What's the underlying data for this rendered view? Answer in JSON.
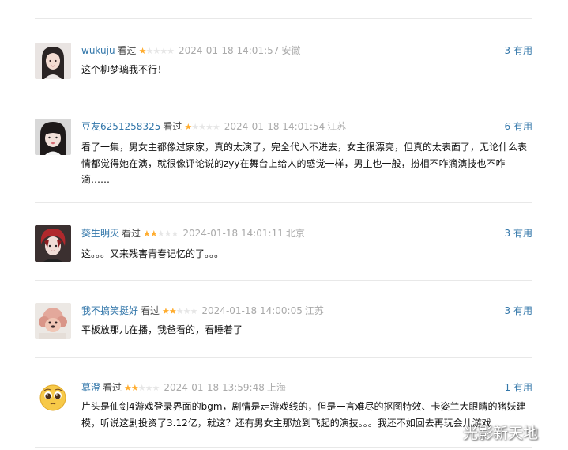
{
  "comments": [
    {
      "user": "wukuju",
      "status": "看过",
      "rating": 1,
      "time": "2024-01-18 14:01:57",
      "location": "安徽",
      "votes": "3 有用",
      "text": "这个柳梦璃我不行！",
      "avatar_icon": "avatar-girl-dark-hair"
    },
    {
      "user": "豆友6251258325",
      "status": "看过",
      "rating": 1,
      "time": "2024-01-18 14:01:54",
      "location": "江苏",
      "votes": "6 有用",
      "text": "看了一集，男女主都像过家家，真的太演了，完全代入不进去，女主很漂亮，但真的太表面了，无论什么表情都觉得她在演，就很像评论说的zyy在舞台上给人的感觉一样，男主也一般，扮相不咋滴演技也不咋滴……",
      "avatar_icon": "avatar-girl-bangs"
    },
    {
      "user": "葵生明灭",
      "status": "看过",
      "rating": 2,
      "time": "2024-01-18 14:01:11",
      "location": "北京",
      "votes": "3 有用",
      "text": "这。。。又来残害青春记忆的了。。。",
      "avatar_icon": "avatar-boy-red-hair"
    },
    {
      "user": "我不搞笑挺好",
      "status": "看过",
      "rating": 2,
      "time": "2024-01-18 14:00:05",
      "location": "江苏",
      "votes": "3 有用",
      "text": "平板放那儿在播，我爸看的，看睡着了",
      "avatar_icon": "avatar-pink-dog"
    },
    {
      "user": "慕澄",
      "status": "看过",
      "rating": 2,
      "time": "2024-01-18 13:59:48",
      "location": "上海",
      "votes": "1 有用",
      "text": "片头是仙剑4游戏登录界面的bgm，剧情是走游戏线的，但是一言难尽的抠图特效、卡姿兰大眼睛的猪妖建模，听说这剧投资了3.12亿，就这？还有男女主那尬到飞起的演技。。。我还不如回去再玩会儿游戏",
      "avatar_icon": "avatar-pleading-emoji"
    }
  ],
  "watermark": "光影新天地",
  "colors": {
    "link": "#3377aa",
    "star_on": "#ffac2d",
    "star_off": "#e6e6e6",
    "meta_gray": "#aaaaaa",
    "divider": "#e8e8e8"
  }
}
